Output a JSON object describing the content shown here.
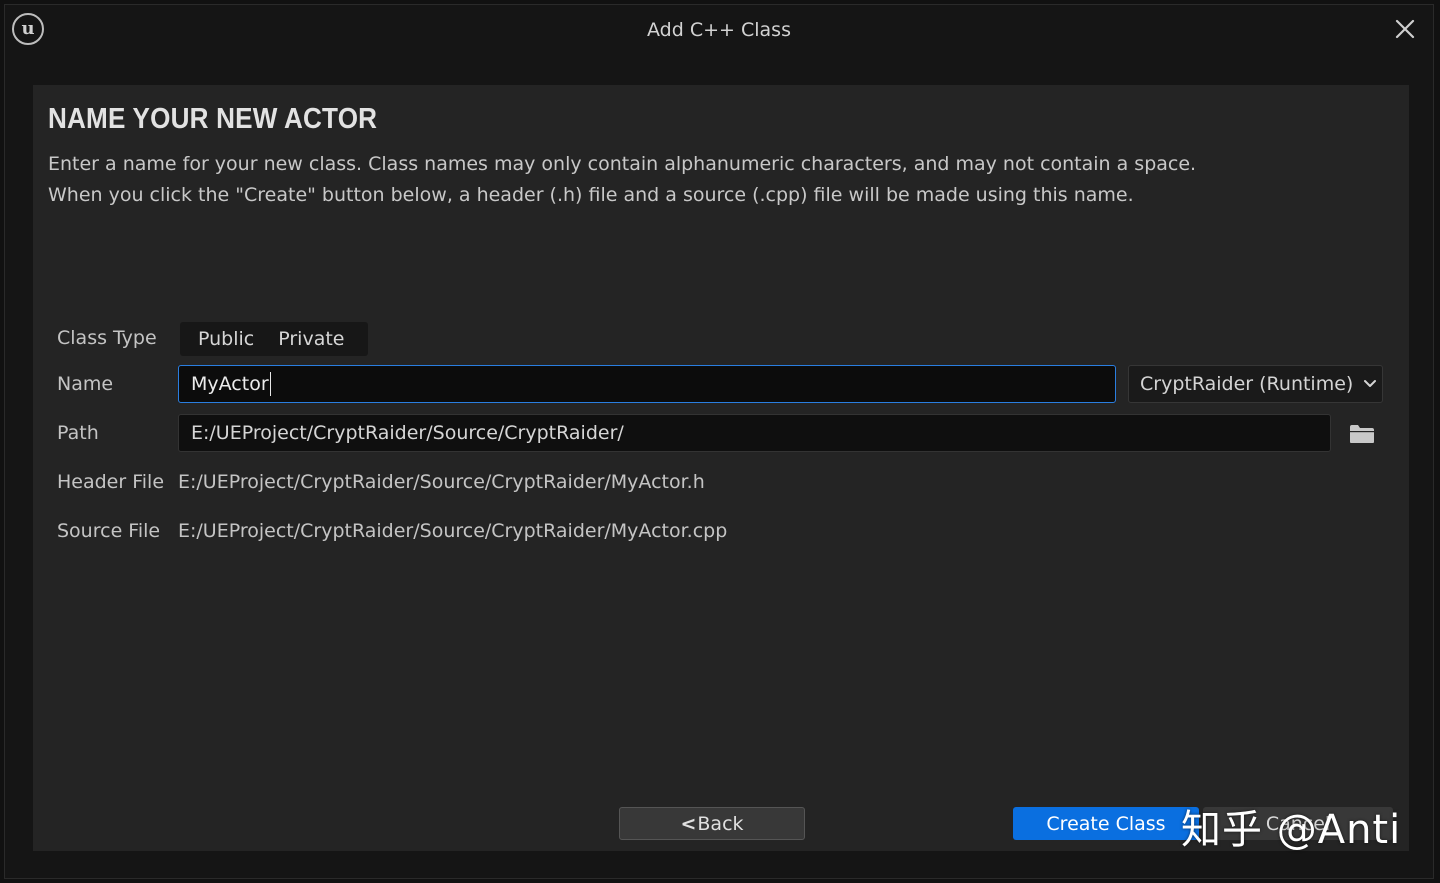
{
  "window": {
    "title": "Add C++ Class",
    "logo_text": "u"
  },
  "page": {
    "heading": "NAME YOUR NEW ACTOR",
    "description_line1": "Enter a name for your new class. Class names may only contain alphanumeric characters, and may not contain a space.",
    "description_line2": "When you click the \"Create\" button below, a header (.h) file and a source (.cpp) file will be made using this name."
  },
  "form": {
    "class_type": {
      "label": "Class Type",
      "options": [
        "Public",
        "Private"
      ]
    },
    "name": {
      "label": "Name",
      "value": "MyActor"
    },
    "module": {
      "selected": "CryptRaider (Runtime)"
    },
    "path": {
      "label": "Path",
      "value": "E:/UEProject/CryptRaider/Source/CryptRaider/"
    },
    "header_file": {
      "label": "Header File",
      "value": "E:/UEProject/CryptRaider/Source/CryptRaider/MyActor.h"
    },
    "source_file": {
      "label": "Source File",
      "value": "E:/UEProject/CryptRaider/Source/CryptRaider/MyActor.cpp"
    }
  },
  "buttons": {
    "back_arrow": "<",
    "back": "Back",
    "create": "Create Class",
    "cancel": "Cancel"
  },
  "watermark": "知乎 @Anti",
  "colors": {
    "accent": "#0a6fe0",
    "focus_border": "#2a7ee0",
    "panel": "#242424",
    "window": "#151515"
  },
  "icons": {
    "close": "close-icon",
    "module_dropdown": "chevron-down-icon",
    "browse": "folder-icon",
    "logo": "unreal-logo-icon"
  }
}
